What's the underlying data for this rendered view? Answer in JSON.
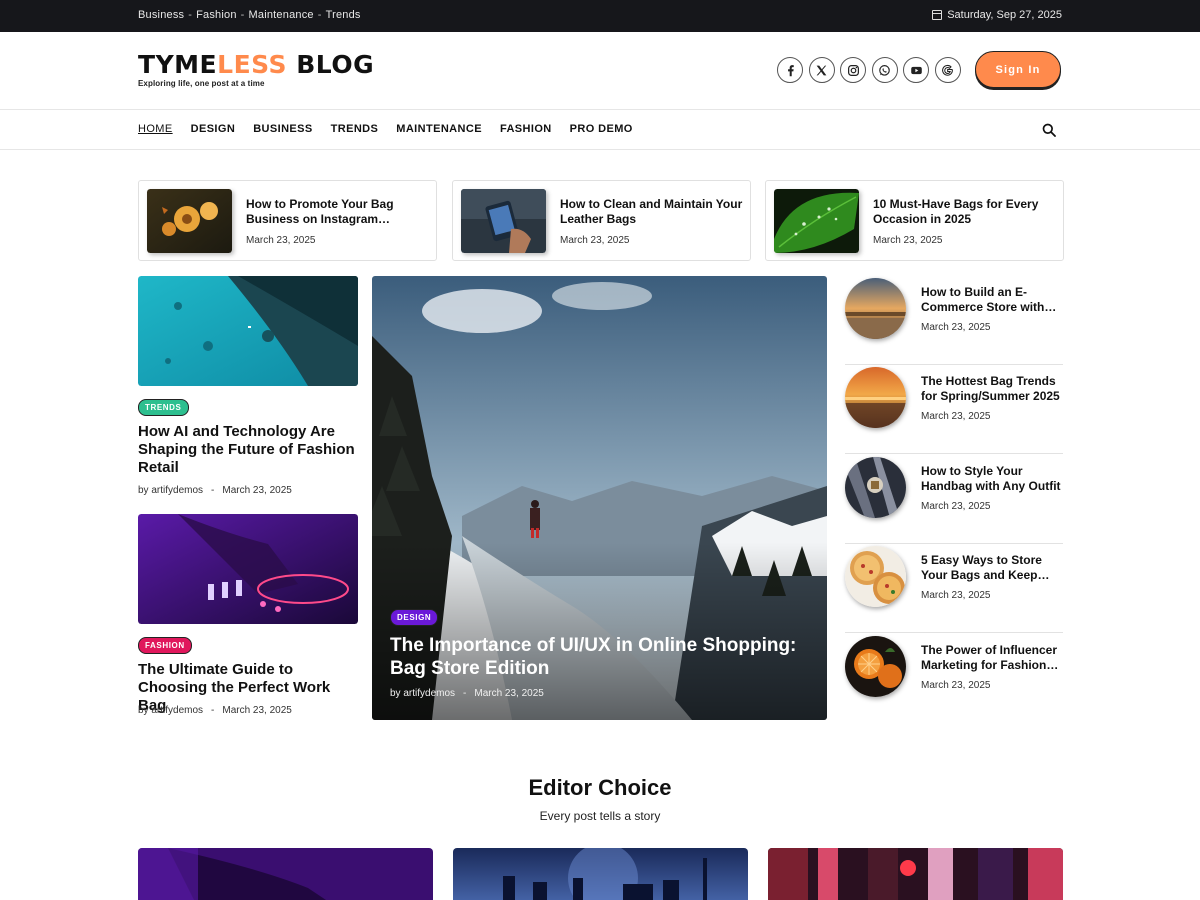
{
  "topbar": {
    "categories": [
      "Business",
      "Fashion",
      "Maintenance",
      "Trends"
    ],
    "separator": "-",
    "date": "Saturday, Sep 27, 2025"
  },
  "header": {
    "logo_part1": "T",
    "logo_part2": "Y",
    "logo_part3": "ME",
    "logo_accent": "LESS",
    "logo_part4": " BLOG",
    "tagline": "Exploring life, one post at a time",
    "socials": [
      "facebook-icon",
      "x-icon",
      "instagram-icon",
      "whatsapp-icon",
      "youtube-icon",
      "google-icon"
    ],
    "signin_label": "Sign In",
    "accent_color": "#ff8a4c"
  },
  "nav": {
    "items": [
      "HOME",
      "DESIGN",
      "BUSINESS",
      "TRENDS",
      "MAINTENANCE",
      "FASHION",
      "PRO DEMO"
    ],
    "active": "HOME"
  },
  "mini_posts": [
    {
      "title": "How to Promote Your Bag Business on Instagram…",
      "date": "March 23, 2025"
    },
    {
      "title": "How to Clean and Maintain Your Leather Bags",
      "date": "March 23, 2025"
    },
    {
      "title": "10 Must-Have Bags for Every Occasion in 2025",
      "date": "March 23, 2025"
    }
  ],
  "left_posts": [
    {
      "badge": "TRENDS",
      "badge_color": "#2dbf8f",
      "title": "How AI and Technology Are Shaping the Future of Fashion Retail",
      "author": "by artifydemos",
      "dash": "-",
      "date": "March 23, 2025"
    },
    {
      "badge": "FASHION",
      "badge_color": "#e0175c",
      "title": "The Ultimate Guide to Choosing the Perfect Work Bag",
      "author": "by artifydemos",
      "dash": "-",
      "date": "March 23, 2025"
    }
  ],
  "hero": {
    "badge": "DESIGN",
    "badge_color": "#6a19d8",
    "title": "The Importance of UI/UX in Online Shopping: Bag Store Edition",
    "author": "by artifydemos",
    "dash": "-",
    "date": "March 23, 2025"
  },
  "right_posts": [
    {
      "title": "How to Build an E-Commerce Store with…",
      "date": "March 23, 2025"
    },
    {
      "title": "The Hottest Bag Trends for Spring/Summer 2025",
      "date": "March 23, 2025"
    },
    {
      "title": "How to Style Your Handbag with Any Outfit",
      "date": "March 23, 2025"
    },
    {
      "title": "5 Easy Ways to Store Your Bags and Keep…",
      "date": "March 23, 2025"
    },
    {
      "title": "The Power of Influencer Marketing for Fashion…",
      "date": "March 23, 2025"
    }
  ],
  "editor_choice": {
    "title": "Editor Choice",
    "subtitle": "Every post tells a story"
  }
}
